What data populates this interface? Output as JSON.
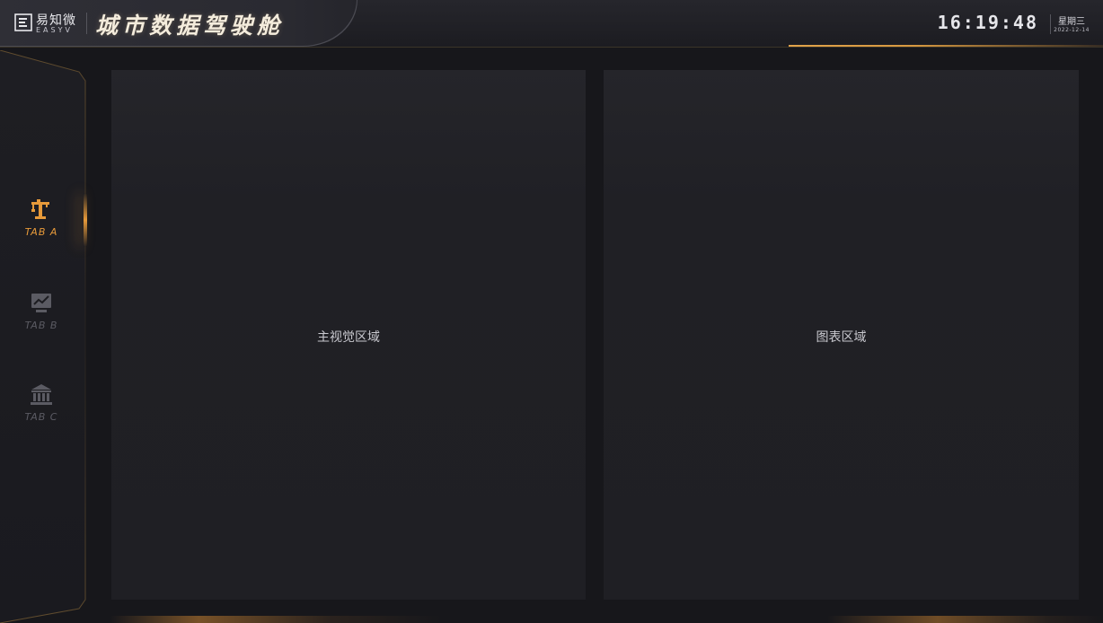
{
  "header": {
    "logo_cn": "易知微",
    "logo_en": "EASYV",
    "title": "城市数据驾驶舱",
    "time": "16:19:48",
    "weekday": "星期三",
    "date": "2022-12-14"
  },
  "sidebar": {
    "tabs": [
      {
        "label": "TAB A",
        "icon": "crane-icon",
        "active": true
      },
      {
        "label": "TAB B",
        "icon": "monitor-chart-icon",
        "active": false
      },
      {
        "label": "TAB C",
        "icon": "bank-icon",
        "active": false
      }
    ]
  },
  "main": {
    "main_visual_label": "主视觉区域",
    "chart_area_label": "图表区域"
  },
  "colors": {
    "accent": "#e79a3a",
    "background": "#17171b",
    "panel": "#1f1f24"
  }
}
